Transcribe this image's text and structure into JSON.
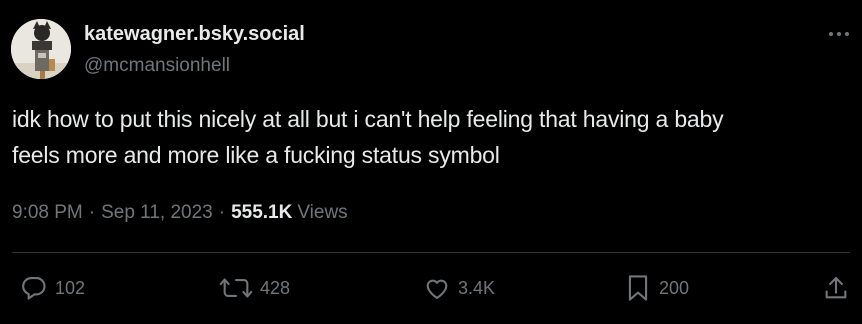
{
  "author": {
    "display_name": "katewagner.bsky.social",
    "handle": "@mcmansionhell"
  },
  "tweet": {
    "text": "idk how to put this nicely at all but i can't help feeling that having a baby\nfeels more and more like a fucking status symbol"
  },
  "meta": {
    "time": "9:08 PM",
    "separator": "·",
    "date": "Sep 11, 2023",
    "views_count": "555.1K",
    "views_label": "Views"
  },
  "actions": {
    "replies": "102",
    "reposts": "428",
    "likes": "3.4K",
    "bookmarks": "200"
  },
  "icons": {
    "more": "more-horizontal-icon",
    "reply": "reply-bubble-icon",
    "repost": "repost-icon",
    "like": "heart-icon",
    "bookmark": "bookmark-icon",
    "share": "share-icon"
  },
  "colors": {
    "background": "#000000",
    "primary_text": "#e7e9ea",
    "secondary_text": "#71767b",
    "divider": "#2f3336"
  }
}
